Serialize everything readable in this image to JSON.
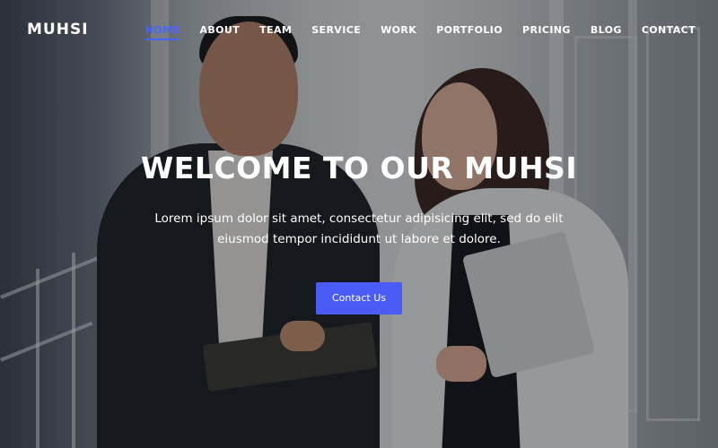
{
  "brand": {
    "logo": "MUHSI",
    "accent_color": "#4a5cf5"
  },
  "nav": {
    "items": [
      {
        "label": "HOME",
        "active": true
      },
      {
        "label": "ABOUT",
        "active": false
      },
      {
        "label": "TEAM",
        "active": false
      },
      {
        "label": "SERVICE",
        "active": false
      },
      {
        "label": "WORK",
        "active": false
      },
      {
        "label": "PORTFOLIO",
        "active": false
      },
      {
        "label": "PRICING",
        "active": false
      },
      {
        "label": "BLOG",
        "active": false
      },
      {
        "label": "CONTACT",
        "active": false
      }
    ]
  },
  "hero": {
    "title": "WELCOME TO OUR MUHSI",
    "description": "Lorem ipsum dolor sit amet, consectetur adipisicing elit, sed do elit eiusmod tempor incididunt ut labore et dolore.",
    "cta_label": "Contact Us"
  }
}
